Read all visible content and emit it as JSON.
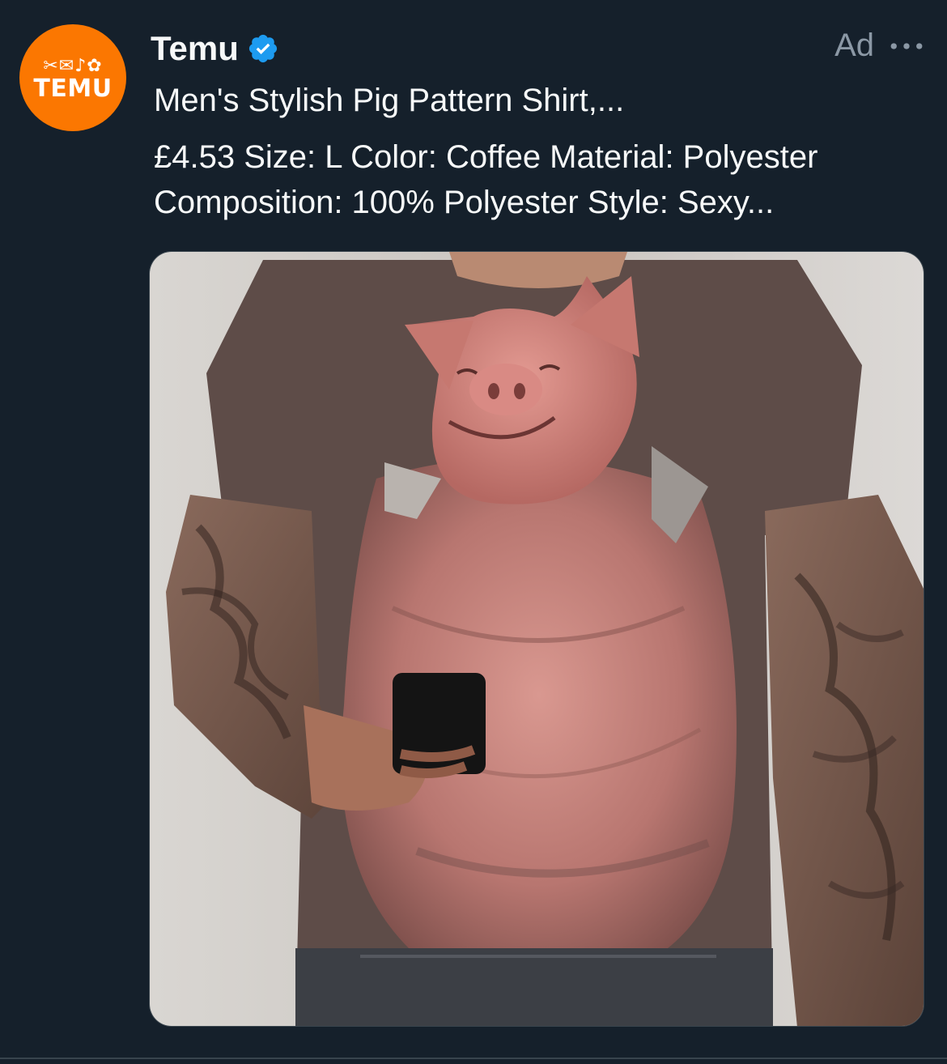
{
  "post": {
    "author": {
      "name": "Temu",
      "verified": true,
      "avatar": {
        "logo_text": "TEMU",
        "logo_glyphs": "✂✉♪✿",
        "background": "#fb7701"
      }
    },
    "ad_label": "Ad",
    "more_icon": "more-horizontal-icon",
    "title": "Men's Stylish Pig Pattern Shirt,...",
    "description": "£4.53 Size: L Color: Coffee Material: Polyester Composition: 100% Polyester Style: Sexy...",
    "verified_badge_color": "#1d9bf0"
  },
  "theme": {
    "background": "#15202b",
    "text_primary": "#f7f9f9",
    "text_secondary": "#8b98a5",
    "border": "#38444d"
  }
}
